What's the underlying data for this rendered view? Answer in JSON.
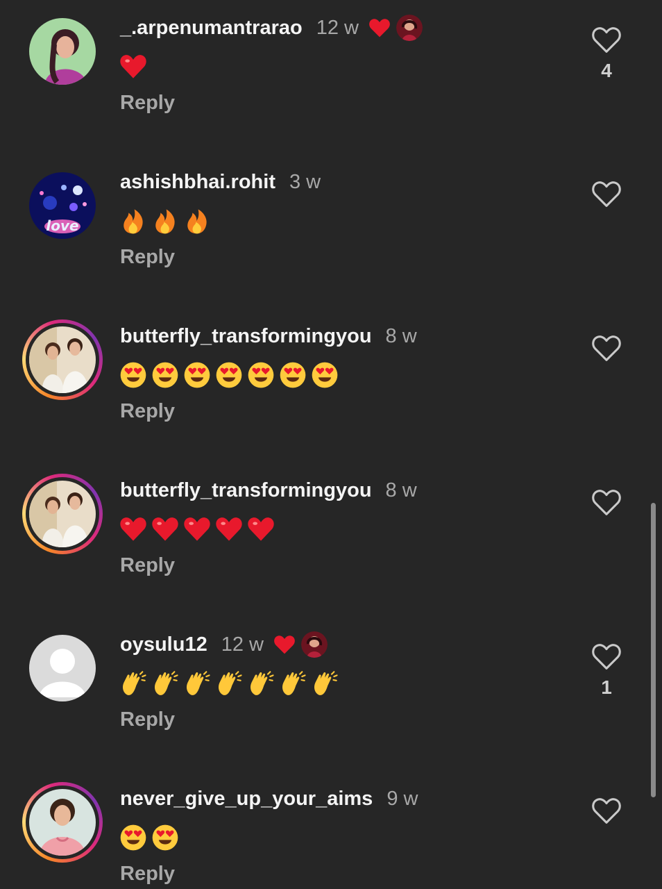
{
  "comments": [
    {
      "username": "_.arpenumantrarao",
      "time": "12 w",
      "creator_liked": true,
      "emoji": "heart",
      "emoji_count": 1,
      "reply_label": "Reply",
      "like_count": "4",
      "avatar": "woman-portrait",
      "ring": false
    },
    {
      "username": "ashishbhai.rohit",
      "time": "3 w",
      "creator_liked": false,
      "emoji": "fire",
      "emoji_count": 3,
      "reply_label": "Reply",
      "like_count": "",
      "avatar": "love-lights",
      "ring": false
    },
    {
      "username": "butterfly_transformingyou",
      "time": "8 w",
      "creator_liked": false,
      "emoji": "heart-eyes",
      "emoji_count": 7,
      "reply_label": "Reply",
      "like_count": "",
      "avatar": "two-girls",
      "ring": true
    },
    {
      "username": "butterfly_transformingyou",
      "time": "8 w",
      "creator_liked": false,
      "emoji": "heart",
      "emoji_count": 5,
      "reply_label": "Reply",
      "like_count": "",
      "avatar": "two-girls",
      "ring": true
    },
    {
      "username": "oysulu12",
      "time": "12 w",
      "creator_liked": true,
      "emoji": "clap",
      "emoji_count": 7,
      "reply_label": "Reply",
      "like_count": "1",
      "avatar": "default-user",
      "ring": false
    },
    {
      "username": "never_give_up_your_aims",
      "time": "9 w",
      "creator_liked": false,
      "emoji": "heart-eyes",
      "emoji_count": 2,
      "reply_label": "Reply",
      "like_count": "",
      "avatar": "woman-pink",
      "ring": true
    }
  ],
  "colors": {
    "background": "#262626",
    "username": "#f4f4f4",
    "muted": "#a8a8a8",
    "heart": "#e8192c",
    "ring": "#dd2a7b"
  }
}
